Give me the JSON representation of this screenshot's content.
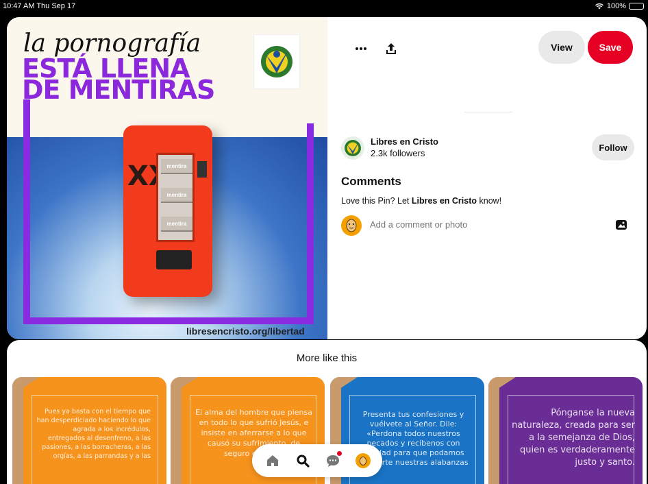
{
  "status_bar": {
    "time": "10:47 AM  Thu Sep 17",
    "battery": "100%"
  },
  "pin": {
    "image_script": "la pornografía",
    "image_headline_1": "ESTÁ LLENA",
    "image_headline_2": "DE MENTIRAS",
    "image_shelf_1": "mentira",
    "image_shelf_2": "mentira",
    "image_shelf_3": "mentira",
    "image_xxx": "XXX",
    "image_url": "libresencristo.org/libertad"
  },
  "actions": {
    "more_icon": "ellipsis-icon",
    "share_icon": "share-icon",
    "view_label": "View",
    "save_label": "Save"
  },
  "creator": {
    "name": "Libres en Cristo",
    "followers": "2.3k followers",
    "follow_label": "Follow"
  },
  "comments": {
    "heading": "Comments",
    "prompt_pre": "Love this Pin? Let ",
    "prompt_name": "Libres en Cristo",
    "prompt_post": " know!",
    "input_placeholder": "Add a comment or photo",
    "photo_icon": "image-icon"
  },
  "more_like_this": {
    "title": "More like this",
    "tiles": [
      {
        "color": "#f6931d",
        "text": "Pues ya basta con el tiempo que han desperdiciado haciendo lo que agrada a los incrédulos, entregados al desenfreno, a las pasiones, a las borracheras, a las orgías, a las parrandas y a las"
      },
      {
        "color": "#f6931d",
        "text": "El alma del hombre que piensa en todo lo que sufrió Jesús, e insiste en aferrarse a lo que causó su sufrimiento, de seguro enferma"
      },
      {
        "color": "#1a73c4",
        "text": "Presenta tus confesiones y vuélvete al Señor. Dile: «Perdona todos nuestros pecados y recíbenos con bondad para que podamos ofrecerte nuestras alabanzas"
      },
      {
        "color": "#6a2c95",
        "text": "Pónganse la nueva naturaleza, creada para ser a la semejanza de Dios, quien es verdaderamente justo y santo."
      }
    ]
  },
  "navbar": {
    "items": [
      "home-icon",
      "search-icon",
      "messages-icon",
      "profile-icon"
    ]
  }
}
